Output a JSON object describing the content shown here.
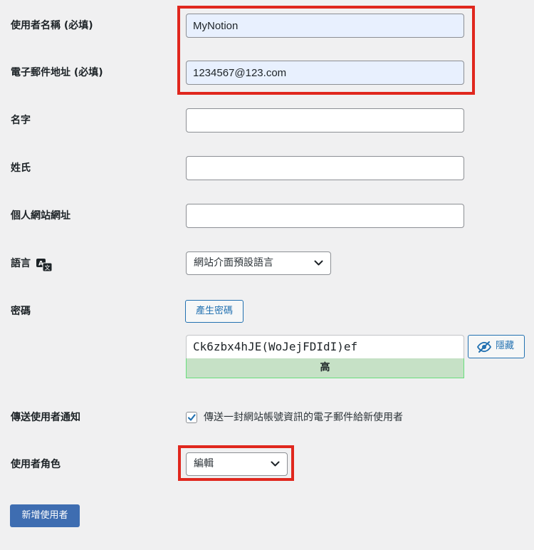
{
  "form": {
    "username": {
      "label": "使用者名稱 (必填)",
      "value": "MyNotion"
    },
    "email": {
      "label": "電子郵件地址 (必填)",
      "value": "1234567@123.com"
    },
    "first_name": {
      "label": "名字",
      "value": ""
    },
    "last_name": {
      "label": "姓氏",
      "value": ""
    },
    "website": {
      "label": "個人網站網址",
      "value": ""
    },
    "language": {
      "label": "語言",
      "selected": "網站介面預設語言",
      "icon": "translation-icon"
    },
    "password": {
      "label": "密碼",
      "generate_button": "產生密碼",
      "value": "Ck6zbx4hJE(WoJejFDIdI)ef",
      "hide_button": "隱藏",
      "hide_icon": "eye-slash-icon",
      "strength": "高"
    },
    "notify": {
      "label": "傳送使用者通知",
      "checkbox_label": "傳送一封網站帳號資訊的電子郵件給新使用者",
      "checked": true
    },
    "role": {
      "label": "使用者角色",
      "selected": "編輯"
    },
    "submit_label": "新增使用者"
  },
  "colors": {
    "background": "#f0f0f1",
    "accent": "#2271b1",
    "primary_button": "#3e6db1",
    "highlight": "#e0271e",
    "strength_bg": "#c6e1c6"
  }
}
